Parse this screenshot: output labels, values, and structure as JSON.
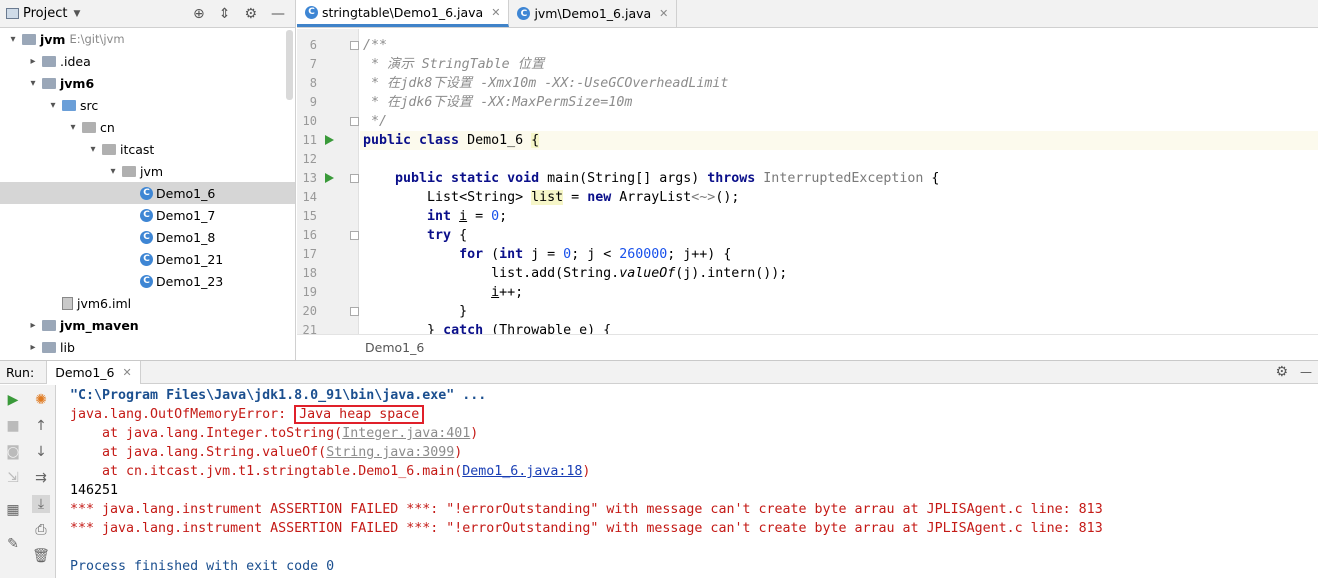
{
  "project": {
    "title": "Project",
    "tree": [
      {
        "label": "jvm",
        "extra": "E:\\git\\jvm",
        "indent": 0,
        "arrow": "▾",
        "icon": "folder",
        "bold": true
      },
      {
        "label": ".idea",
        "indent": 1,
        "arrow": "▸",
        "icon": "folder"
      },
      {
        "label": "jvm6",
        "indent": 1,
        "arrow": "▾",
        "icon": "folder",
        "bold": true
      },
      {
        "label": "src",
        "indent": 2,
        "arrow": "▾",
        "icon": "src"
      },
      {
        "label": "cn",
        "indent": 3,
        "arrow": "▾",
        "icon": "pkg"
      },
      {
        "label": "itcast",
        "indent": 4,
        "arrow": "▾",
        "icon": "pkg"
      },
      {
        "label": "jvm",
        "indent": 5,
        "arrow": "▾",
        "icon": "pkg"
      },
      {
        "label": "Demo1_6",
        "indent": 6,
        "arrow": "",
        "icon": "class",
        "selected": true
      },
      {
        "label": "Demo1_7",
        "indent": 6,
        "arrow": "",
        "icon": "class"
      },
      {
        "label": "Demo1_8",
        "indent": 6,
        "arrow": "",
        "icon": "class"
      },
      {
        "label": "Demo1_21",
        "indent": 6,
        "arrow": "",
        "icon": "class"
      },
      {
        "label": "Demo1_23",
        "indent": 6,
        "arrow": "",
        "icon": "class"
      },
      {
        "label": "jvm6.iml",
        "indent": 2,
        "arrow": "",
        "icon": "iml"
      },
      {
        "label": "jvm_maven",
        "indent": 1,
        "arrow": "▸",
        "icon": "folder",
        "bold": true
      },
      {
        "label": "lib",
        "indent": 1,
        "arrow": "▸",
        "icon": "folder"
      }
    ]
  },
  "tabs": [
    {
      "label": "stringtable\\Demo1_6.java",
      "active": true
    },
    {
      "label": "jvm\\Demo1_6.java",
      "active": false
    }
  ],
  "editor": {
    "breadcrumb": "Demo1_6",
    "line_numbers": [
      "6",
      "7",
      "8",
      "9",
      "10",
      "11",
      "12",
      "13",
      "14",
      "15",
      "16",
      "17",
      "18",
      "19",
      "20",
      "21"
    ],
    "comment_lines": [
      "/**",
      " * 演示 StringTable 位置",
      " * 在jdk8下设置 -Xmx10m -XX:-UseGCOverheadLimit",
      " * 在jdk6下设置 -XX:MaxPermSize=10m",
      " */"
    ],
    "code": {
      "l11_kw": "public class",
      "l11_name": " Demo1_6 ",
      "l11_brace": "{",
      "l13_kw": "    public static void",
      "l13_sig": " main(String[] args) ",
      "l13_throws": "throws",
      "l13_exc": " InterruptedException",
      "l13_end": " {",
      "l14_a": "        List<String> ",
      "l14_var": "list",
      "l14_b": " = ",
      "l14_new": "new",
      "l14_c": " ArrayList",
      "l14_diamond": "<~>",
      "l14_d": "();",
      "l15_kw": "        int",
      "l15_a": " ",
      "l15_var": "i",
      "l15_b": " = ",
      "l15_num": "0",
      "l15_c": ";",
      "l16_kw": "        try",
      "l16_a": " {",
      "l17_kw": "            for",
      "l17_a": " (",
      "l17_kw2": "int",
      "l17_b": " j = ",
      "l17_n1": "0",
      "l17_c": "; j < ",
      "l17_n2": "260000",
      "l17_d": "; j++) {",
      "l18_a": "                list.add(String.",
      "l18_it": "valueOf",
      "l18_b": "(j).intern());",
      "l19_a": "                ",
      "l19_var": "i",
      "l19_b": "++;",
      "l20_a": "            }",
      "l21_a": "        } ",
      "l21_kw": "catch",
      "l21_b": " (Throwable e) {"
    }
  },
  "run": {
    "label": "Run:",
    "tab": "Demo1_6",
    "console": {
      "cmd": "\"C:\\Program Files\\Java\\jdk1.8.0_91\\bin\\java.exe\" ...",
      "err_prefix": "java.lang.OutOfMemoryError: ",
      "err_boxed": "Java heap space",
      "st1_a": "    at java.lang.Integer.toString(",
      "st1_link": "Integer.java:401",
      "st1_b": ")",
      "st2_a": "    at java.lang.String.valueOf(",
      "st2_link": "String.java:3099",
      "st2_b": ")",
      "st3_a": "    at cn.itcast.jvm.t1.stringtable.Demo1_6.main(",
      "st3_link": "Demo1_6.java:18",
      "st3_b": ")",
      "count": "146251",
      "assert1": "*** java.lang.instrument ASSERTION FAILED ***: \"!errorOutstanding\" with message can't create byte arrau at JPLISAgent.c line: 813",
      "assert2": "*** java.lang.instrument ASSERTION FAILED ***: \"!errorOutstanding\" with message can't create byte arrau at JPLISAgent.c line: 813",
      "finished": "Process finished with exit code 0"
    }
  }
}
